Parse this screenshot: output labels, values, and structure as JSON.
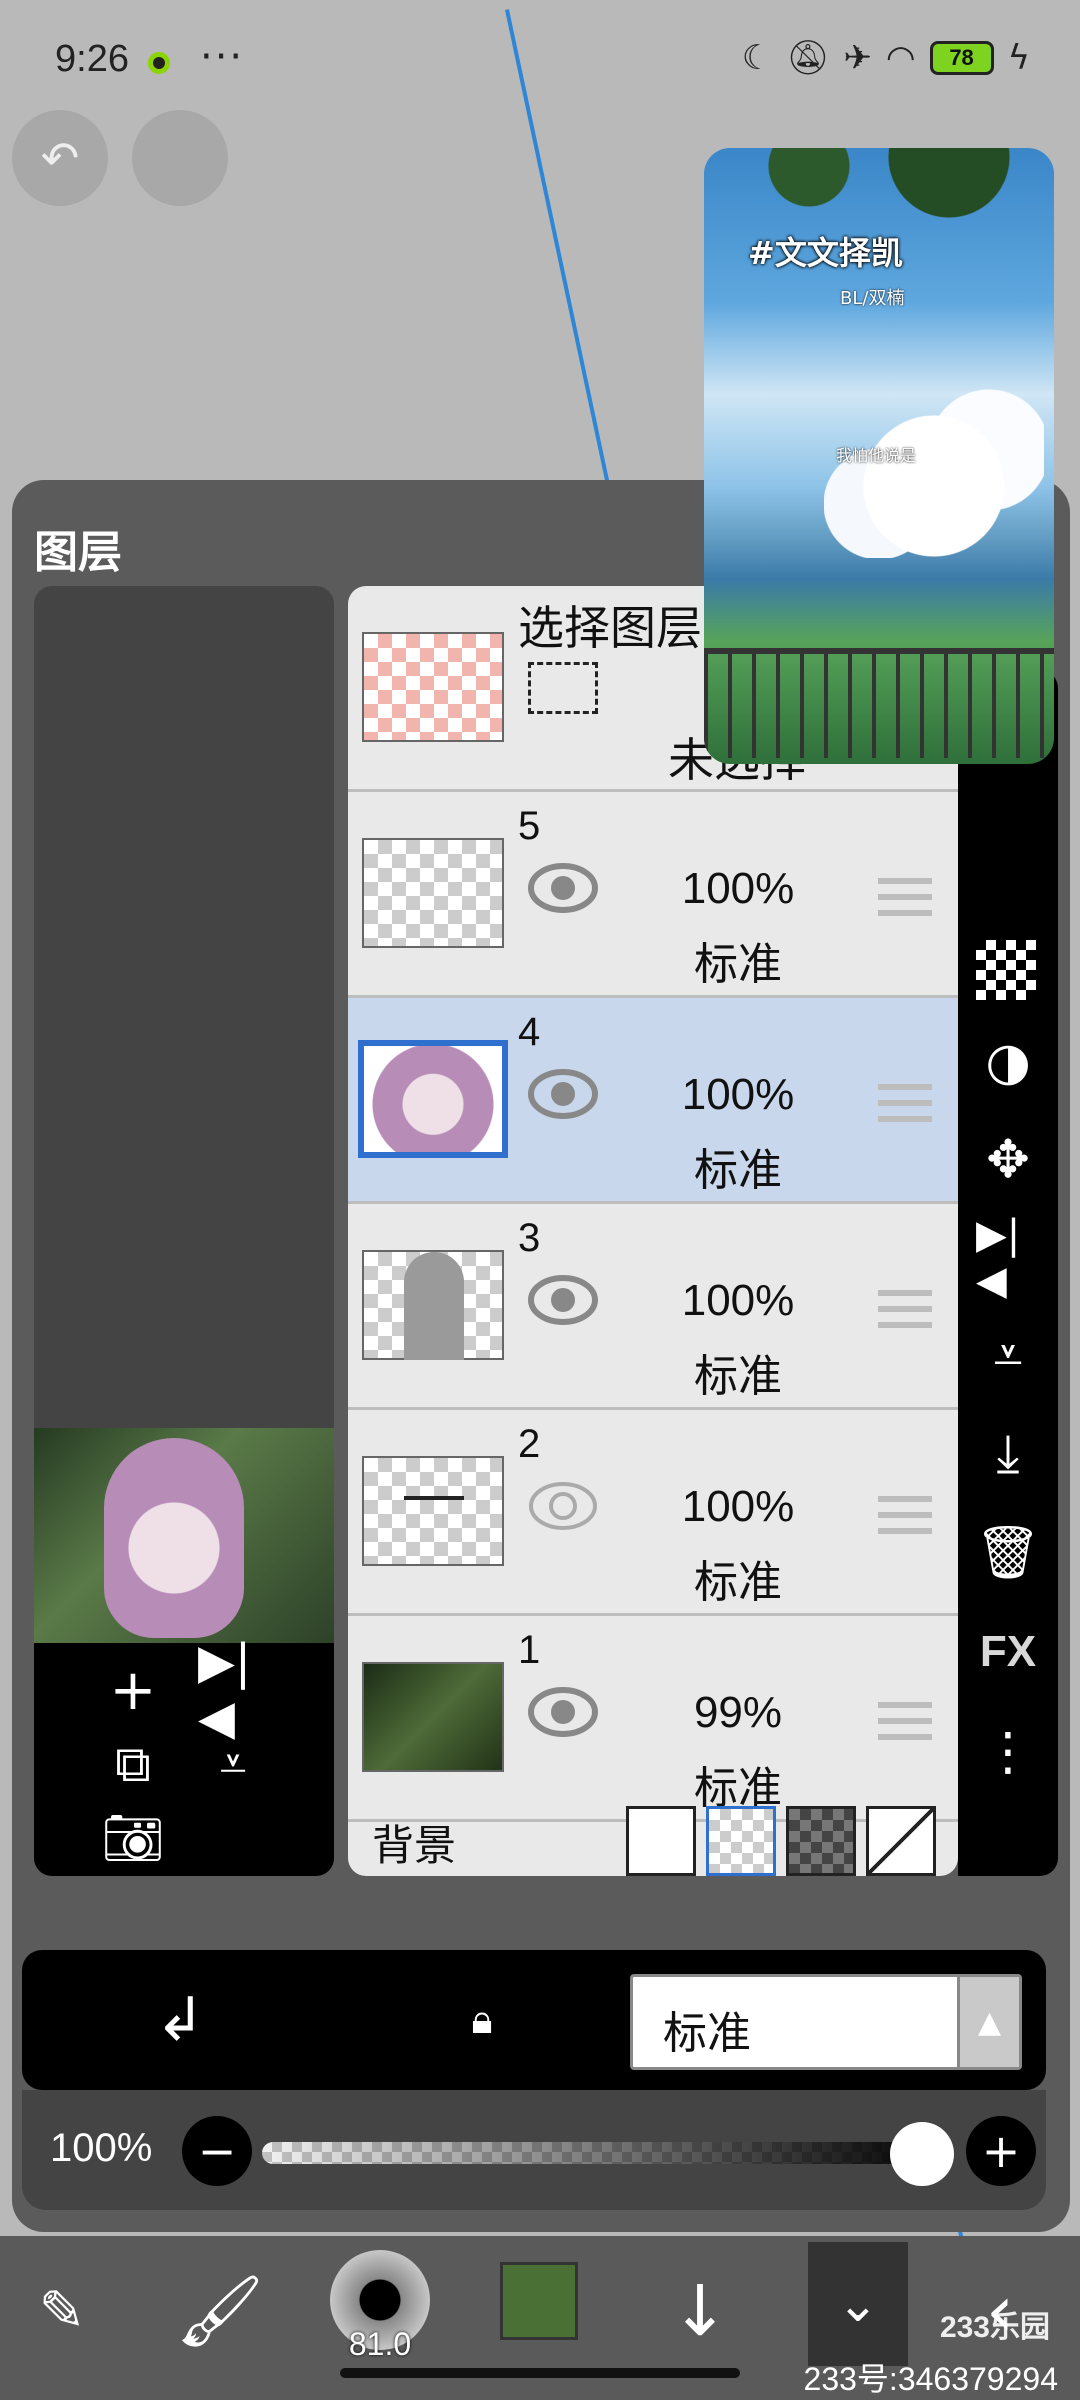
{
  "status_bar": {
    "time": "9:26",
    "more": "···",
    "battery": "78",
    "icons": [
      "moon-icon",
      "mute-icon",
      "airplane-icon",
      "wifi-icon",
      "charging-icon"
    ]
  },
  "reference_image": {
    "title": "#文文择凯",
    "subtitle": "BL/双楠",
    "caption": "我怕他说是"
  },
  "panel": {
    "title": "图层",
    "selection_layer": {
      "label": "选择图层",
      "state": "未选择"
    },
    "layers": [
      {
        "number": "5",
        "opacity": "100%",
        "mode": "标准",
        "visible": true,
        "selected": false
      },
      {
        "number": "4",
        "opacity": "100%",
        "mode": "标准",
        "visible": true,
        "selected": true
      },
      {
        "number": "3",
        "opacity": "100%",
        "mode": "标准",
        "visible": true,
        "selected": false
      },
      {
        "number": "2",
        "opacity": "100%",
        "mode": "标准",
        "visible": false,
        "selected": false
      },
      {
        "number": "1",
        "opacity": "99%",
        "mode": "标准",
        "visible": true,
        "selected": false
      }
    ],
    "background_label": "背景",
    "right_tools": [
      "checker-icon",
      "contrast-icon",
      "move-icon",
      "flip-horizontal-icon",
      "flip-vertical-icon",
      "merge-down-icon",
      "trash-icon",
      "FX",
      "more-vertical-icon"
    ],
    "fx_label": "FX"
  },
  "blend": {
    "mode": "标准",
    "alpha_symbol": "α"
  },
  "opacity": {
    "label": "100%",
    "value": 1.0
  },
  "bottom_toolbar": {
    "brush_size": "81.0",
    "color": "#4b7035"
  },
  "watermark": {
    "logo": "233乐园",
    "id_text": "233号:346379294"
  },
  "colors": {
    "accent_selected": "#2f6fce",
    "selected_row": "#c9d7ec"
  }
}
